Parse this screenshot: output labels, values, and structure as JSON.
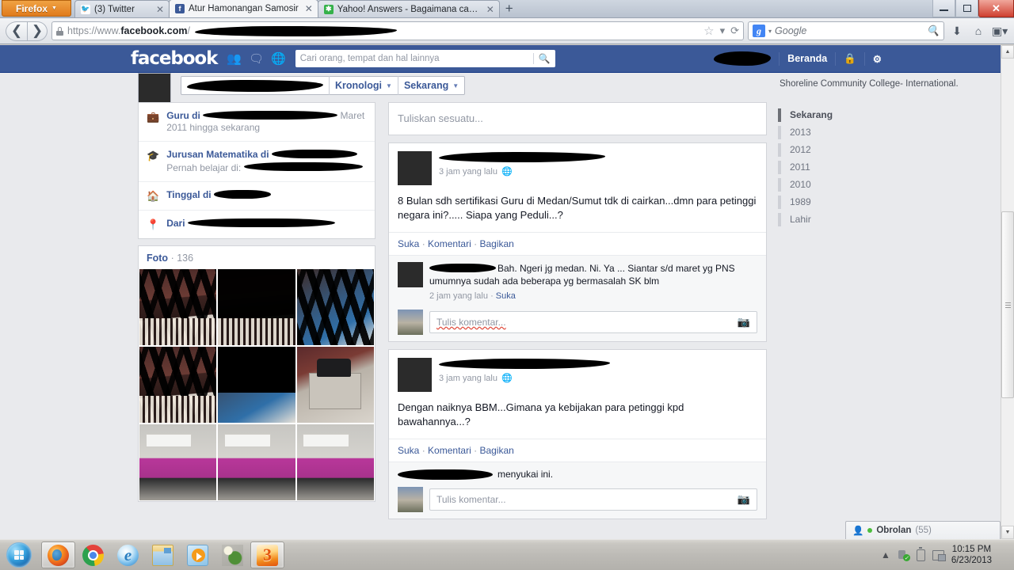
{
  "browser": {
    "app_button": "Firefox",
    "tabs": [
      {
        "title": "(3) Twitter",
        "favicon": "twitter-icon",
        "active": false
      },
      {
        "title": "Atur Hamonangan Samosir",
        "favicon": "facebook-icon",
        "active": true
      },
      {
        "title": "Yahoo! Answers - Bagaimana cara m...",
        "favicon": "yahoo-icon",
        "active": false
      }
    ],
    "new_tab_label": "+",
    "url_prefix": "https://www.facebook.com/",
    "url_scheme": "https://www.",
    "url_domain": "facebook.com",
    "url_path_redacted": true,
    "search_engine": "Google",
    "search_placeholder": "Google",
    "window_controls": {
      "minimize": "–",
      "restore": "❐",
      "close": "✕"
    }
  },
  "facebook": {
    "logo": "facebook",
    "header_icons": [
      "friend-requests-icon",
      "messages-icon",
      "notifications-icon"
    ],
    "search_placeholder": "Cari orang, tempat dan hal lainnya",
    "home_label": "Beranda",
    "profile_nav": {
      "timeline_label": "Kronologi",
      "now_label": "Sekarang"
    },
    "sidebar_info": [
      {
        "icon": "briefcase-icon",
        "title": "Guru di",
        "sub": "Maret 2011 hingga sekarang"
      },
      {
        "icon": "graduation-icon",
        "title": "Jurusan Matematika di",
        "sub": "Pernah belajar di:"
      },
      {
        "icon": "home-icon",
        "title": "Tinggal di",
        "sub": ""
      },
      {
        "icon": "location-pin-icon",
        "title": "Dari",
        "sub": ""
      }
    ],
    "photos": {
      "label": "Foto",
      "separator": "·",
      "count": "136"
    },
    "composer_placeholder": "Tuliskan sesuatu...",
    "posts": [
      {
        "time": "3 jam yang lalu",
        "privacy": "public-globe-icon",
        "text": "8 Bulan sdh sertifikasi Guru di Medan/Sumut tdk di cairkan...dmn para petinggi negara ini?..... Siapa yang Peduli...?",
        "actions": {
          "like": "Suka",
          "comment": "Komentari",
          "share": "Bagikan",
          "sep": "·"
        },
        "comment": {
          "text": "Bah. Ngeri jg medan. Ni. Ya ... Siantar s/d maret yg PNS umumnya sudah ada beberapa yg bermasalah SK blm",
          "time": "2 jam yang lalu",
          "like": "Suka",
          "sep": "·"
        },
        "comment_placeholder": "Tulis komentar...",
        "comment_misspelled": true
      },
      {
        "time": "3 jam yang lalu",
        "privacy": "public-globe-icon",
        "text": "Dengan naiknya BBM...Gimana ya kebijakan para petinggi kpd bawahannya...?",
        "actions": {
          "like": "Suka",
          "comment": "Komentari",
          "share": "Bagikan",
          "sep": "·"
        },
        "like_text": "menyukai ini.",
        "comment_placeholder": "Tulis komentar...",
        "comment_misspelled": false
      }
    ],
    "right_column": {
      "college_line": "Shoreline Community College- International.",
      "years": [
        {
          "label": "Sekarang",
          "current": true
        },
        {
          "label": "2013",
          "current": false
        },
        {
          "label": "2012",
          "current": false
        },
        {
          "label": "2011",
          "current": false
        },
        {
          "label": "2010",
          "current": false
        },
        {
          "label": "1989",
          "current": false
        },
        {
          "label": "Lahir",
          "current": false
        }
      ]
    },
    "chat": {
      "label": "Obrolan",
      "count": "(55)"
    }
  },
  "taskbar": {
    "start": "windows-start-orb",
    "apps": [
      {
        "name": "firefox",
        "active": true
      },
      {
        "name": "chrome",
        "active": false
      },
      {
        "name": "internet-explorer",
        "active": false
      },
      {
        "name": "file-explorer",
        "active": false
      },
      {
        "name": "windows-media-player",
        "active": false
      },
      {
        "name": "flower-app",
        "active": false
      },
      {
        "name": "three-app",
        "active": true
      }
    ],
    "tray": {
      "overflow": "▲",
      "time": "10:15 PM",
      "date": "6/23/2013"
    }
  },
  "colors": {
    "fb_blue": "#3b5998",
    "fb_link": "#3b5998",
    "page_bg": "#e9eaed",
    "firefox_orange": "#e07b1c",
    "close_red": "#cf4030"
  }
}
